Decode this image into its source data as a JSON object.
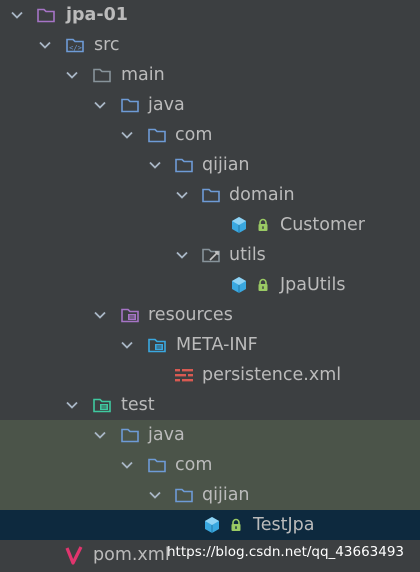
{
  "project_tree": {
    "root": {
      "label": "jpa-01"
    },
    "src": {
      "label": "src"
    },
    "main": {
      "label": "main"
    },
    "main_java": {
      "label": "java"
    },
    "main_com": {
      "label": "com"
    },
    "main_qijian": {
      "label": "qijian"
    },
    "domain": {
      "label": "domain"
    },
    "customer": {
      "label": "Customer"
    },
    "utils": {
      "label": "utils"
    },
    "jpautils": {
      "label": "JpaUtils"
    },
    "resources": {
      "label": "resources"
    },
    "meta_inf": {
      "label": "META-INF"
    },
    "persistence": {
      "label": "persistence.xml"
    },
    "test": {
      "label": "test"
    },
    "test_java": {
      "label": "java"
    },
    "test_com": {
      "label": "com"
    },
    "test_qijian": {
      "label": "qijian"
    },
    "testjpa": {
      "label": "TestJpa"
    },
    "pom": {
      "label": "pom.xml"
    }
  },
  "watermark": "https://blog.csdn.net/qq_43663493",
  "colors": {
    "background": "#3c3f41",
    "test_highlight": "#4b5449",
    "selection": "#0d293e",
    "folder": "#87939a",
    "source_folder": "#6e9bd6",
    "resources_folder": "#a674c6",
    "test_folder": "#3fc9a0",
    "class_icon": "#3aa8e0",
    "lock": "#9aca64",
    "xml": "#d85a52",
    "maven": "#e0356e"
  }
}
